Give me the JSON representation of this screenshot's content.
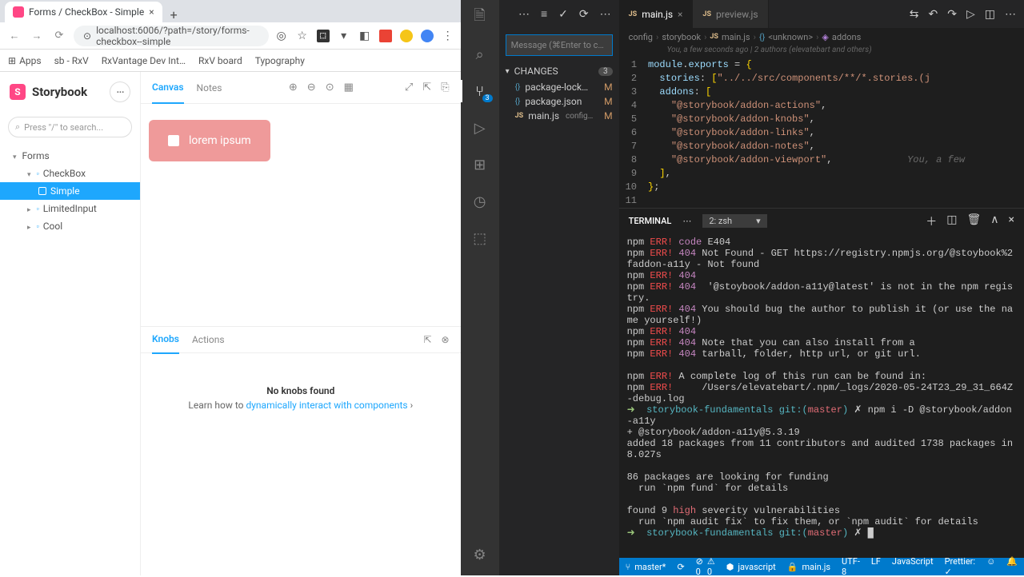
{
  "browser": {
    "tab_title": "Forms / CheckBox - Simple",
    "url": "localhost:6006/?path=/story/forms-checkbox--simple",
    "bookmarks": [
      "Apps",
      "sb - RxV",
      "RxVantage Dev Int…",
      "RxV board",
      "Typography"
    ]
  },
  "storybook": {
    "logo": "Storybook",
    "search_placeholder": "Press \"/\" to search...",
    "tree": {
      "forms": "Forms",
      "checkbox": "CheckBox",
      "simple": "Simple",
      "limited": "LimitedInput",
      "cool": "Cool"
    },
    "tabs": {
      "canvas": "Canvas",
      "notes": "Notes"
    },
    "demo_label": "lorem ipsum",
    "panel_tabs": {
      "knobs": "Knobs",
      "actions": "Actions"
    },
    "no_knobs": "No knobs found",
    "hint_prefix": "Learn how to ",
    "hint_link": "dynamically interact with components"
  },
  "vscode": {
    "scm": {
      "message_placeholder": "Message (⌘Enter to c…",
      "changes_label": "CHANGES",
      "changes_count": "3",
      "files": [
        {
          "name": "package-lock…",
          "icon": "{}",
          "status": "M"
        },
        {
          "name": "package.json",
          "icon": "{}",
          "status": "M"
        },
        {
          "name": "main.js",
          "icon": "JS",
          "sub": "config…",
          "status": "M"
        }
      ],
      "badge": "3"
    },
    "tabs": {
      "main": "main.js",
      "preview": "preview.js"
    },
    "breadcrumb": [
      "config",
      "storybook",
      "main.js",
      "<unknown>",
      "addons"
    ],
    "blame": "You, a few seconds ago | 2 authors (elevatebart and others)",
    "code": {
      "l1": "module.exports = {",
      "l2": "  stories: [\"../../src/components/**/*.stories.(j",
      "l3": "  addons: [",
      "l4": "    \"@storybook/addon-actions\",",
      "l5": "    \"@storybook/addon-knobs\",",
      "l6": "    \"@storybook/addon-links\",",
      "l7": "    \"@storybook/addon-notes\",",
      "l8": "    \"@storybook/addon-viewport\",",
      "l8_comment": "             You, a few",
      "l9": "  ],",
      "l10": "};",
      "l11": ""
    },
    "terminal": {
      "title": "TERMINAL",
      "selector": "2: zsh",
      "lines": [
        {
          "pre": "npm ",
          "err": "ERR!",
          "p404": " code",
          "txt": " E404"
        },
        {
          "pre": "npm ",
          "err": "ERR!",
          "p404": " 404",
          "txt": " Not Found - GET https://registry.npmjs.org/@stoybook%2faddon-a11y - Not found"
        },
        {
          "pre": "npm ",
          "err": "ERR!",
          "p404": " 404",
          "txt": ""
        },
        {
          "pre": "npm ",
          "err": "ERR!",
          "p404": " 404",
          "txt": "  '@stoybook/addon-a11y@latest' is not in the npm registry."
        },
        {
          "pre": "npm ",
          "err": "ERR!",
          "p404": " 404",
          "txt": " You should bug the author to publish it (or use the name yourself!)"
        },
        {
          "pre": "npm ",
          "err": "ERR!",
          "p404": " 404",
          "txt": ""
        },
        {
          "pre": "npm ",
          "err": "ERR!",
          "p404": " 404",
          "txt": " Note that you can also install from a"
        },
        {
          "pre": "npm ",
          "err": "ERR!",
          "p404": " 404",
          "txt": " tarball, folder, http url, or git url."
        },
        {
          "pre": "",
          "txt": ""
        },
        {
          "pre": "npm ",
          "err": "ERR!",
          "txt": " A complete log of this run can be found in:"
        },
        {
          "pre": "npm ",
          "err": "ERR!",
          "txt": "     /Users/elevatebart/.npm/_logs/2020-05-24T23_29_31_664Z-debug.log"
        }
      ],
      "prompt1_proj": "storybook-fundamentals",
      "prompt1_git": " git:(",
      "prompt1_branch": "master",
      "prompt1_close": ") ",
      "prompt1_cmd": "✗ npm i -D @storybook/addon-a11y",
      "install_1": "+ @storybook/addon-a11y@5.3.19",
      "install_2": "added 18 packages from 11 contributors and audited 1738 packages in 8.027s",
      "install_3": "",
      "install_4": "86 packages are looking for funding",
      "install_5": "  run `npm fund` for details",
      "install_6": "",
      "found_a": "found 9 ",
      "found_high": "high",
      "found_b": " severity vulnerabilities",
      "install_8": "  run `npm audit fix` to fix them, or `npm audit` for details",
      "prompt2_cmd": "✗ "
    },
    "statusbar": {
      "branch": "master*",
      "sync": "⟳",
      "errors": "⊘ 0",
      "warnings": "⚠ 0",
      "lang_icon_text": "javascript",
      "file": "main.js",
      "encoding": "UTF-8",
      "eol": "LF",
      "lang": "JavaScript",
      "prettier": "Prettier: ✓",
      "feedback": "☺"
    }
  }
}
